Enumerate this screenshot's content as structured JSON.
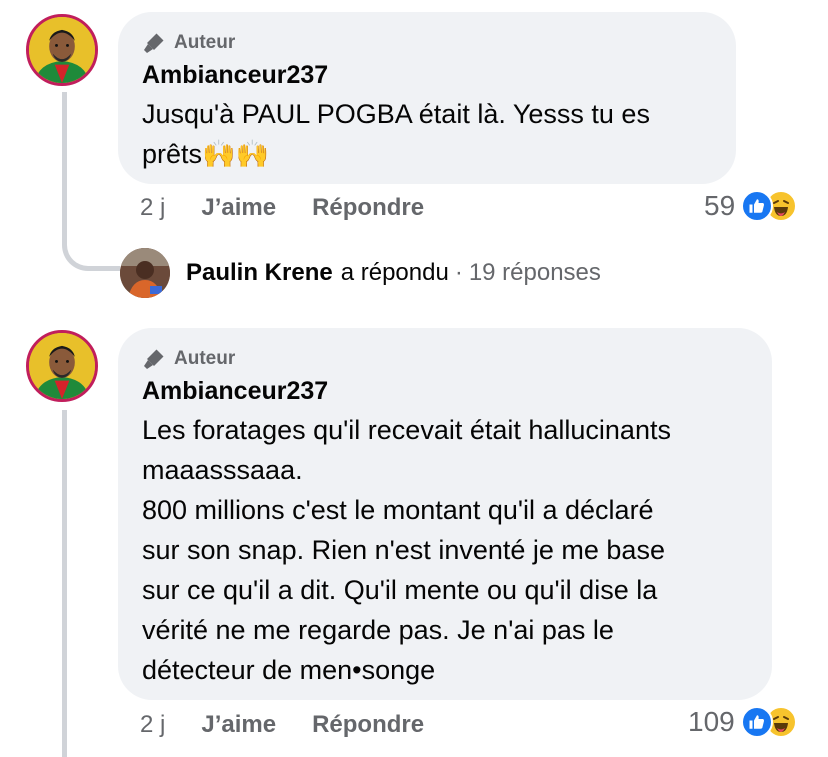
{
  "comments": [
    {
      "badge": "Auteur",
      "username": "Ambianceur237",
      "text_lines": [
        "Jusqu'à PAUL POGBA était là. Yesss tu es",
        "prêts🙌🙌"
      ],
      "time": "2 j",
      "like_label": "J’aime",
      "reply_label": "Répondre",
      "reaction_count": "59",
      "reaction_icons": [
        "like-icon",
        "haha-icon"
      ]
    },
    {
      "badge": "Auteur",
      "username": "Ambianceur237",
      "text_lines": [
        "Les foratages qu'il recevait était hallucinants",
        "maaasssaaa.",
        "800 millions c'est le montant qu'il a déclaré",
        "sur son snap. Rien n'est inventé je me base",
        "sur ce qu'il a dit. Qu'il mente ou qu'il dise la",
        "vérité ne me regarde pas. Je n'ai pas le",
        "détecteur de men•songe"
      ],
      "time": "2 j",
      "like_label": "J’aime",
      "reply_label": "Répondre",
      "reaction_count": "109",
      "reaction_icons": [
        "like-icon",
        "haha-icon"
      ]
    }
  ],
  "replies_summary": {
    "name": "Paulin Krene",
    "action": "a répondu",
    "separator": "·",
    "count": "19 réponses"
  },
  "colors": {
    "like_blue": "#1877f2",
    "haha_yellow": "#f7c32d",
    "bubble_bg": "#f0f2f5",
    "secondary_text": "#65676b",
    "avatar_ring": "#c11e5c"
  }
}
